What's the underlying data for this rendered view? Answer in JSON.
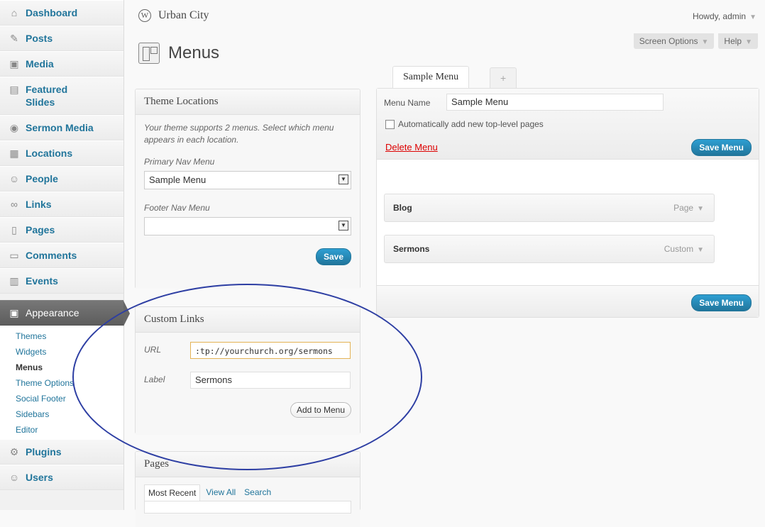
{
  "sidebar": {
    "items": [
      {
        "label": "Dashboard",
        "icon": "⌂",
        "icon_name": "home-icon"
      },
      {
        "label": "Posts",
        "icon": "✎",
        "icon_name": "pushpin-icon"
      },
      {
        "label": "Media",
        "icon": "▣",
        "icon_name": "media-icon"
      },
      {
        "label": "Featured Slides",
        "icon": "▤",
        "icon_name": "slides-icon"
      },
      {
        "label": "Sermon Media",
        "icon": "◉",
        "icon_name": "microphone-icon"
      },
      {
        "label": "Locations",
        "icon": "▦",
        "icon_name": "map-icon"
      },
      {
        "label": "People",
        "icon": "☺",
        "icon_name": "person-icon"
      },
      {
        "label": "Links",
        "icon": "∞",
        "icon_name": "link-icon"
      },
      {
        "label": "Pages",
        "icon": "▯",
        "icon_name": "pages-icon"
      },
      {
        "label": "Comments",
        "icon": "▭",
        "icon_name": "comment-icon"
      },
      {
        "label": "Events",
        "icon": "▥",
        "icon_name": "calendar-icon"
      }
    ],
    "appearance": {
      "label": "Appearance",
      "icon": "▣"
    },
    "submenu": [
      "Themes",
      "Widgets",
      "Menus",
      "Theme Options",
      "Social Footer",
      "Sidebars",
      "Editor"
    ],
    "plugins": {
      "label": "Plugins",
      "icon": "⚙"
    },
    "users": {
      "label": "Users",
      "icon": "☺"
    }
  },
  "header": {
    "site_title": "Urban City",
    "howdy": "Howdy, admin",
    "screen_options": "Screen Options",
    "help": "Help",
    "page_title": "Menus",
    "caret": "▼",
    "wp_logo": "W"
  },
  "theme_locations": {
    "title": "Theme Locations",
    "desc": "Your theme supports 2 menus. Select which menu appears in each location.",
    "primary_label": "Primary Nav Menu",
    "primary_value": "Sample Menu",
    "footer_label": "Footer Nav Menu",
    "footer_value": "",
    "save": "Save"
  },
  "custom_links": {
    "title": "Custom Links",
    "url_label": "URL",
    "url_value": ":tp://yourchurch.org/sermons",
    "label_label": "Label",
    "label_value": "Sermons",
    "add": "Add to Menu"
  },
  "pages_box": {
    "title": "Pages",
    "tabs": [
      "Most Recent",
      "View All",
      "Search"
    ]
  },
  "menu_editor": {
    "tab_label": "Sample Menu",
    "plus": "+",
    "name_label": "Menu Name",
    "name_value": "Sample Menu",
    "auto_add": "Automatically add new top-level pages",
    "delete": "Delete Menu",
    "save": "Save Menu",
    "items": [
      {
        "title": "Blog",
        "type": "Page"
      },
      {
        "title": "Sermons",
        "type": "Custom"
      }
    ]
  },
  "colors": {
    "accent": "#21759b",
    "current_menu": "#666666",
    "annotation": "#2d3ea3",
    "delete": "#dd0000"
  }
}
